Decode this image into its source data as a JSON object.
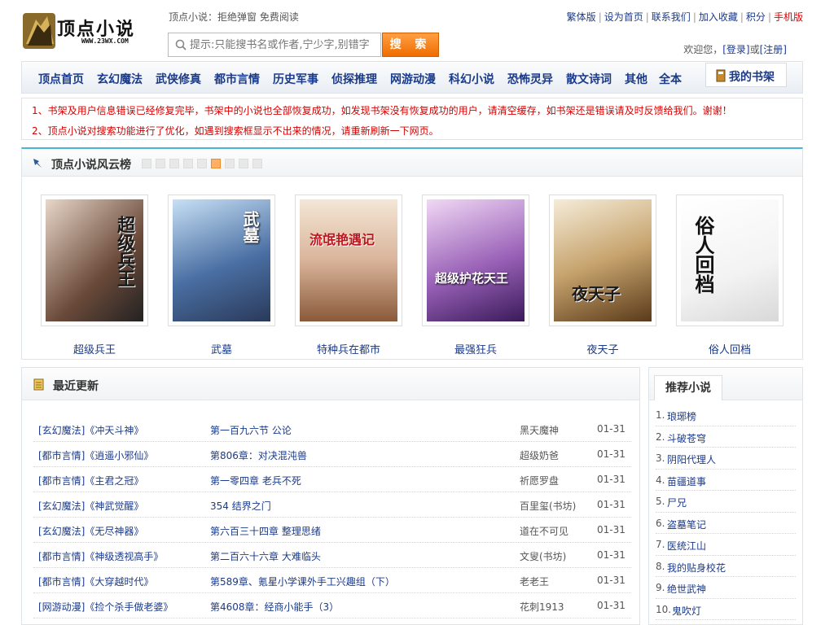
{
  "header": {
    "logo_text": "顶点小说",
    "logo_url": "WWW.23WX.COM",
    "slogan": "顶点小说：拒绝弹窗 免费阅读",
    "search_placeholder": "提示:只能搜书名或作者,宁少字,别错字",
    "search_button": "搜 索",
    "top_links": [
      "繁体版",
      "设为首页",
      "联系我们",
      "加入收藏",
      "积分"
    ],
    "mobile_link": "手机版",
    "welcome": "欢迎您，",
    "login": "[登录]",
    "or": "或",
    "register": "[注册]"
  },
  "nav": {
    "items": [
      "顶点首页",
      "玄幻魔法",
      "武侠修真",
      "都市言情",
      "历史军事",
      "侦探推理",
      "网游动漫",
      "科幻小说",
      "恐怖灵异",
      "散文诗词",
      "其他",
      "全本"
    ],
    "shelf": "我的书架"
  },
  "notices": [
    "1、书架及用户信息错误已经修复完毕，书架中的小说也全部恢复成功，如发现书架没有恢复成功的用户，请清空缓存，如书架还是错误请及时反馈给我们。谢谢！",
    "2、顶点小说对搜索功能进行了优化，如遇到搜索框显示不出来的情况，请重新刷新一下网页。"
  ],
  "ranking": {
    "title": "顶点小说风云榜",
    "active_dot": 5,
    "dot_count": 7,
    "books": [
      {
        "name": "超级兵王",
        "cover_text": "超级兵王",
        "cover_color": "#6b4a3a"
      },
      {
        "name": "武墓",
        "cover_text": "武墓",
        "cover_color": "#4a6fa3"
      },
      {
        "name": "特种兵在都市",
        "cover_text": "流氓艳遇记",
        "cover_color": "#d9b49a"
      },
      {
        "name": "最强狂兵",
        "cover_text": "超级护花天王",
        "cover_color": "#9a62b8"
      },
      {
        "name": "夜天子",
        "cover_text": "夜天子",
        "cover_color": "#c7a46e"
      },
      {
        "name": "俗人回档",
        "cover_text": "俗人回档",
        "cover_color": "#f3f3f3"
      }
    ]
  },
  "latest": {
    "title": "最近更新",
    "rows": [
      {
        "cat": "[玄幻魔法]《冲天斗神》",
        "chap": "第一百九六节 公论",
        "author": "黑天魔神",
        "date": "01-31"
      },
      {
        "cat": "[都市言情]《逍遥小邪仙》",
        "chap": "第806章：对决混沌兽",
        "author": "超级奶爸",
        "date": "01-31"
      },
      {
        "cat": "[都市言情]《主君之冠》",
        "chap": "第一零四章 老兵不死",
        "author": "祈愿罗盘",
        "date": "01-31"
      },
      {
        "cat": "[玄幻魔法]《神武觉醒》",
        "chap": "354 结界之门",
        "author": "百里玺(书坊)",
        "date": "01-31"
      },
      {
        "cat": "[玄幻魔法]《无尽神器》",
        "chap": "第六百三十四章 整理思绪",
        "author": "道在不可见",
        "date": "01-31"
      },
      {
        "cat": "[都市言情]《神级透视高手》",
        "chap": "第二百六十六章 大难临头",
        "author": "文叟(书坊)",
        "date": "01-31"
      },
      {
        "cat": "[都市言情]《大穿越时代》",
        "chap": "第589章、氪星小学课外手工兴趣组（下）",
        "author": "老老王",
        "date": "01-31"
      },
      {
        "cat": "[网游动漫]《捡个杀手做老婆》",
        "chap": "第4608章：经商小能手（3）",
        "author": "花刺1913",
        "date": "01-31"
      }
    ]
  },
  "recommend": {
    "title": "推荐小说",
    "items": [
      "琅琊榜",
      "斗破苍穹",
      "阴阳代理人",
      "苗疆道事",
      "尸兄",
      "盗墓笔记",
      "医统江山",
      "我的贴身校花",
      "绝世武神",
      "鬼吹灯"
    ]
  },
  "colors": {
    "link": "#1a3a8a",
    "notice": "#d40000",
    "search_button": "#f07a10",
    "accent_line": "#4ab3d7"
  }
}
